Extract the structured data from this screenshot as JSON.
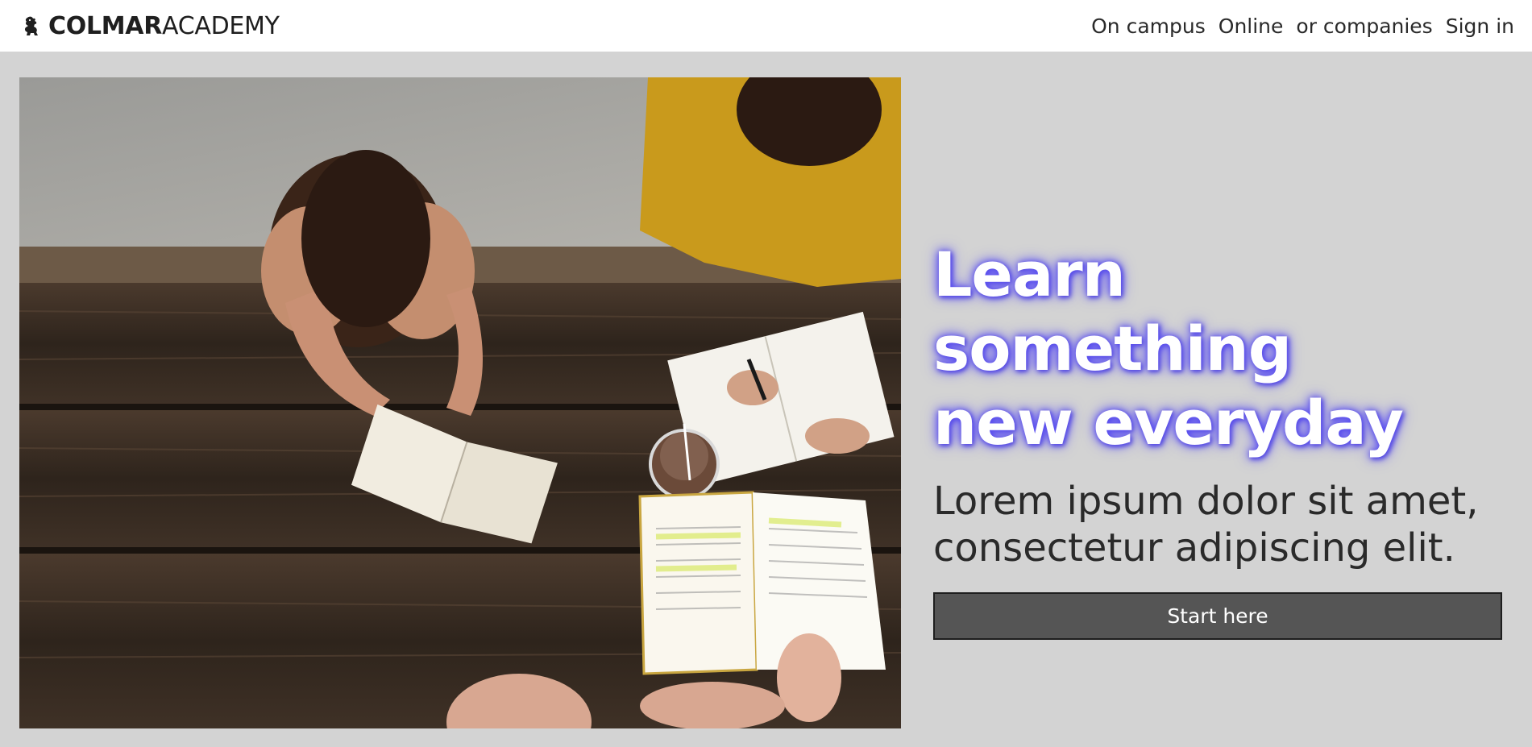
{
  "brand": {
    "name_bold": "COLMAR",
    "name_light": "ACADEMY",
    "logo_icon": "lion-rampant-icon"
  },
  "nav": {
    "items": [
      {
        "label": "On campus"
      },
      {
        "label": "Online"
      },
      {
        "label": "or companies"
      },
      {
        "label": "Sign in"
      }
    ]
  },
  "hero": {
    "image_alt": "Three people reading books and writing at a wooden picnic table",
    "headline_line1": "Learn something",
    "headline_line2": "new everyday",
    "subline_line1": "Lorem ipsum dolor sit amet,",
    "subline_line2": "consectetur adipiscing elit.",
    "cta_label": "Start here"
  },
  "colors": {
    "page_bg": "#d3d3d3",
    "header_bg": "#ffffff",
    "headline_glow": "#5a4ff0",
    "cta_bg": "#555555"
  }
}
